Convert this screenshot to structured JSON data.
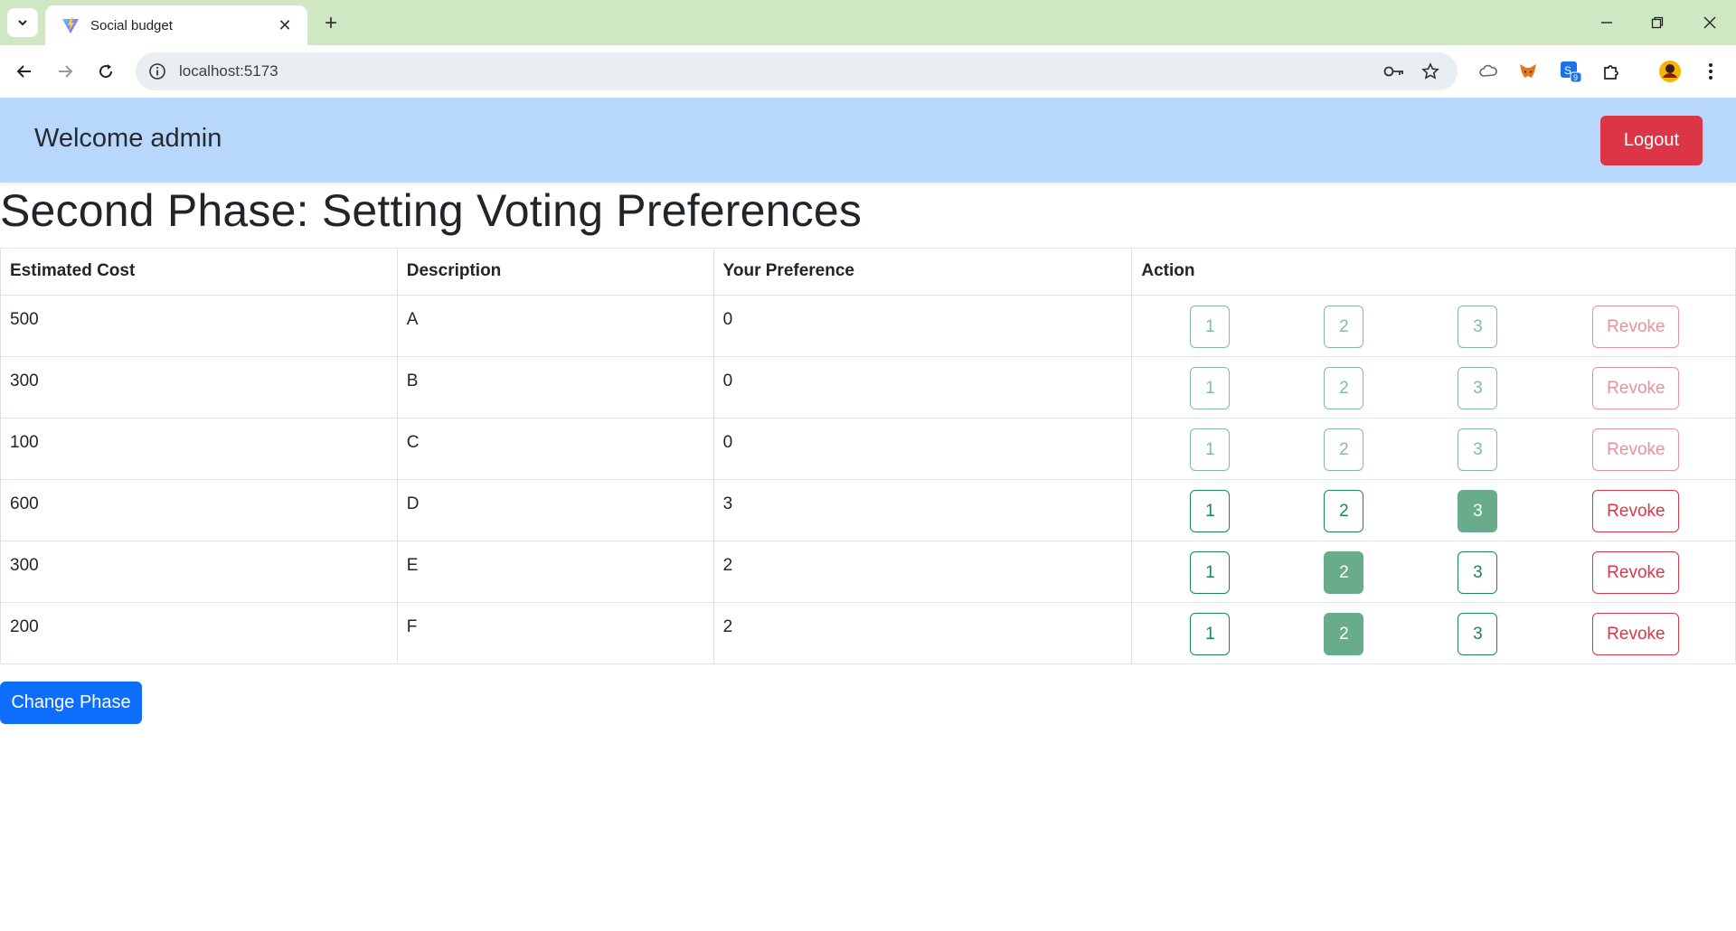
{
  "browser": {
    "tab_title": "Social budget",
    "url": "localhost:5173",
    "extension_badge": "9"
  },
  "navbar": {
    "welcome": "Welcome admin",
    "logout_label": "Logout"
  },
  "page": {
    "title": "Second Phase: Setting Voting Preferences",
    "change_phase_label": "Change Phase"
  },
  "table": {
    "headers": {
      "cost": "Estimated Cost",
      "description": "Description",
      "preference": "Your Preference",
      "action": "Action"
    },
    "button_labels": {
      "one": "1",
      "two": "2",
      "three": "3",
      "revoke": "Revoke"
    },
    "rows": [
      {
        "cost": "500",
        "description": "A",
        "preference": "0"
      },
      {
        "cost": "300",
        "description": "B",
        "preference": "0"
      },
      {
        "cost": "100",
        "description": "C",
        "preference": "0"
      },
      {
        "cost": "600",
        "description": "D",
        "preference": "3"
      },
      {
        "cost": "300",
        "description": "E",
        "preference": "2"
      },
      {
        "cost": "200",
        "description": "F",
        "preference": "2"
      }
    ]
  },
  "colors": {
    "navbar_bg": "#b8d8fb",
    "danger": "#dc3545",
    "success": "#198754",
    "selected_preference": "#68ac8c",
    "primary": "#0d6efd",
    "tabstrip_bg": "#cfe8c3"
  }
}
